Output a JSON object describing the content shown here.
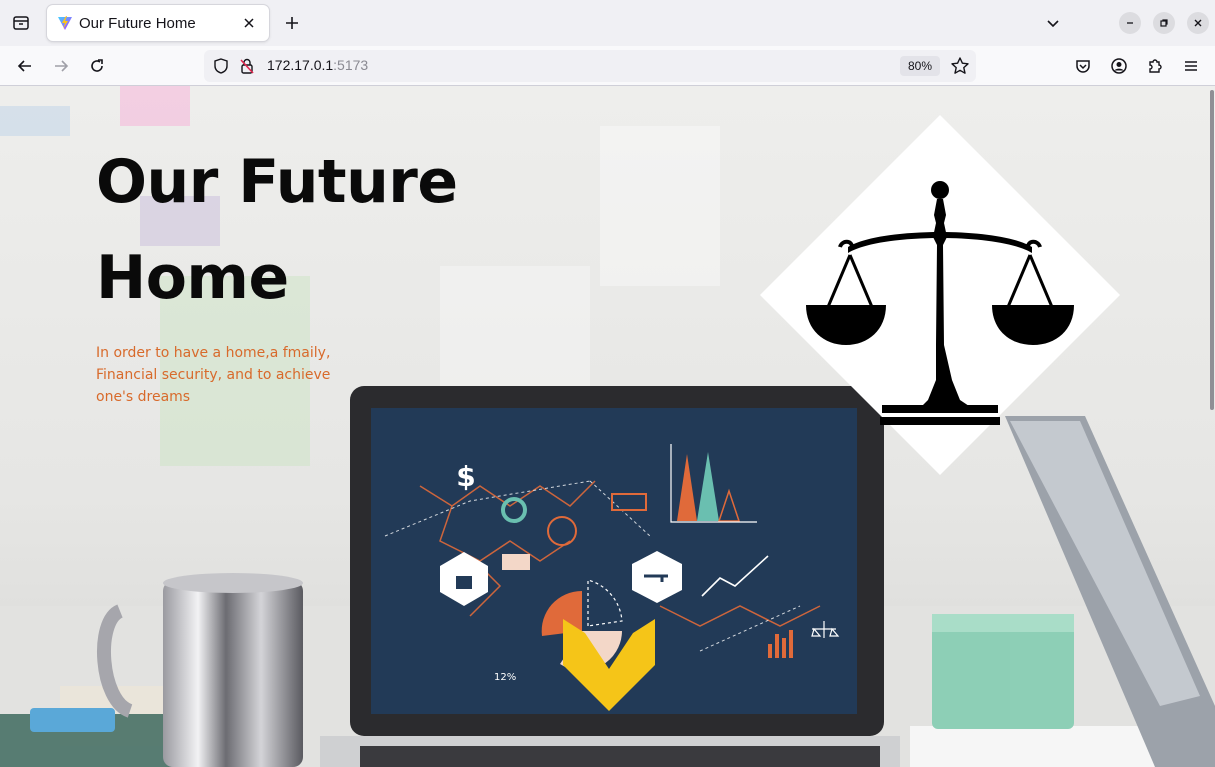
{
  "browser": {
    "tab": {
      "title": "Our Future Home",
      "favicon": "vite-logo-icon"
    },
    "url": {
      "host": "172.17.0.1",
      "port": ":5173"
    },
    "zoom": "80%",
    "icons": {
      "tabs_list": "tab-overview-icon",
      "new_tab": "plus-icon",
      "list_all_tabs": "chevron-down-icon",
      "back": "back-arrow-icon",
      "forward": "forward-arrow-icon",
      "reload": "reload-icon",
      "tracking": "shield-icon",
      "insecure": "insecure-lock-icon",
      "bookmark": "star-icon",
      "pocket": "pocket-icon",
      "account": "account-icon",
      "extensions": "puzzle-icon",
      "menu": "hamburger-menu-icon",
      "minimize": "minimize-icon",
      "restore": "restore-icon",
      "close": "close-icon"
    }
  },
  "hero": {
    "title_line1": "Our Future",
    "title_line2": "Home",
    "subtitle": "In order to have a home,a fmaily, Financial security, and to achieve one's dreams"
  },
  "laptop_labels": {
    "percent": "12%"
  },
  "colors": {
    "title": "#0a0a0a",
    "subtitle": "#d86a2b",
    "accent_yellow": "#f5c518",
    "screen_navy": "#1f3a5a"
  }
}
